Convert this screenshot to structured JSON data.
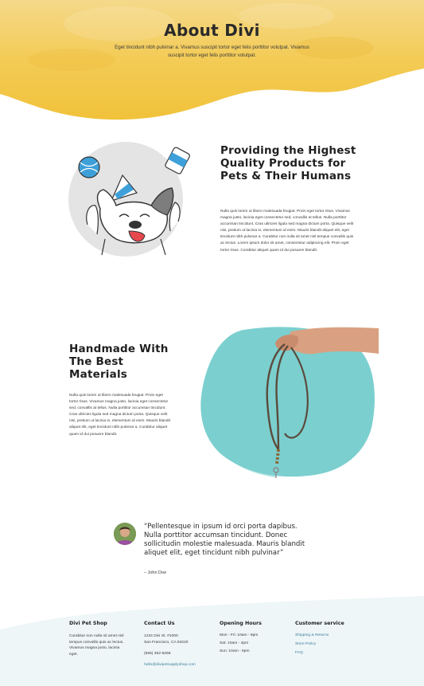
{
  "hero": {
    "title": "About Divi",
    "subtitle": "Eget tincidunt nibh pulvinar a. Vivamus suscipit tortor eget felis porttitor volutpat. Vivamus suscipit tortor eget felis porttitor volutpat."
  },
  "section1": {
    "title": "Providing the Highest Quality Products for Pets & Their Humans",
    "body": "Nulla quis lorem ut libero malesuada feugiat. Proin eget tortor risus. Vivamus magna justo, lacinia eget consectetur sed, convallis at tellus. Nulla porttitor accumsan tincidunt. Cras ultricies ligula sed magna dictum porta. Quisque velit nisi, pretium ut lacinia in, elementum id enim. Mauris blandit aliquet elit, eget tincidunt nibh pulvinar a. Curabitur non nulla sit amet nisl tempus convallis quis ac lectus. Lorem ipsum dolor sit amet, consectetur adipiscing elit. Proin eget tortor risus. Curabitur aliquet quam id dui posuere blandit."
  },
  "section2": {
    "title": "Handmade With The Best Materials",
    "body": "Nulla quis lorem ut libero malesuada feugiat. Proin eget tortor risus. Vivamus magna justo, lacinia eget consectetur sed, convallis at tellus. Nulla porttitor accumsan tincidunt. Cras ultricies ligula sed magna dictum porta. Quisque velit nisi, pretium ut lacinia in, elementum id enim. Mauris blandit aliquet elit, eget tincidunt nibh pulvinar a. Curabitur aliquet quam id dui posuere blandit."
  },
  "testimonial": {
    "quote": "“Pellentesque in ipsum id orci porta dapibus. Nulla porttitor accumsan tincidunt. Donec sollicitudin molestie malesuada. Mauris blandit aliquet elit, eget tincidunt nibh pulvinar”",
    "author": "– John Doe"
  },
  "footer": {
    "shop": {
      "heading": "Divi Pet Shop",
      "text": "Curabitur non nulla sit amet nisl tempus convallis quis ac lectus. Vivamus magna justo, lacinia eget."
    },
    "contact": {
      "heading": "Contact Us",
      "address_line1": "1234 Divi St. #1000",
      "address_line2": "San Francisco, CA 94220",
      "phone": "(555) 352-6258",
      "email": "hello@divipetsupplyshop.com"
    },
    "hours": {
      "heading": "Opening Hours",
      "items": [
        "Mon - Fri: 10am - 8pm",
        "Sat: 10am - 4pm",
        "Sun: 10am - 6pm"
      ]
    },
    "service": {
      "heading": "Customer service",
      "links": [
        "Shipping & Returns",
        "Store Policy",
        "FAQ"
      ]
    }
  },
  "colors": {
    "hero_yellow": "#f2c53d",
    "accent_blue": "#3f7f9c",
    "teal_blob": "#7ccfcf",
    "circle_gray": "#e4e4e4"
  },
  "icons": [
    "dog-illustration",
    "leash-photo",
    "avatar-photo"
  ]
}
